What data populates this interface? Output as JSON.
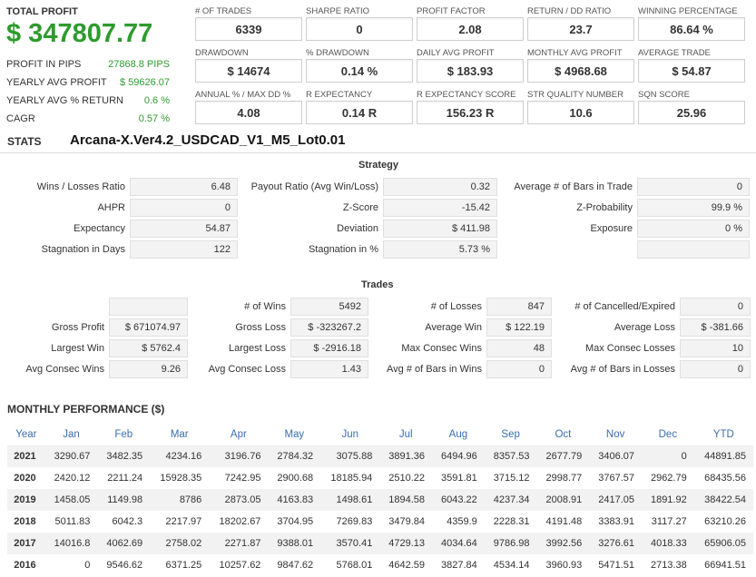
{
  "summary": {
    "total_profit_label": "TOTAL PROFIT",
    "total_profit_value": "$ 347807.77",
    "rows": [
      {
        "label": "PROFIT IN PIPS",
        "value": "27868.8 PIPS"
      },
      {
        "label": "YEARLY AVG PROFIT",
        "value": "$ 59626.07"
      },
      {
        "label": "YEARLY AVG % RETURN",
        "value": "0.6 %"
      },
      {
        "label": "CAGR",
        "value": "0.57 %"
      }
    ]
  },
  "metrics": [
    {
      "label": "# OF TRADES",
      "value": "6339"
    },
    {
      "label": "SHARPE RATIO",
      "value": "0"
    },
    {
      "label": "PROFIT FACTOR",
      "value": "2.08"
    },
    {
      "label": "RETURN / DD RATIO",
      "value": "23.7"
    },
    {
      "label": "WINNING PERCENTAGE",
      "value": "86.64 %"
    },
    {
      "label": "DRAWDOWN",
      "value": "$ 14674"
    },
    {
      "label": "% DRAWDOWN",
      "value": "0.14 %"
    },
    {
      "label": "DAILY AVG PROFIT",
      "value": "$ 183.93"
    },
    {
      "label": "MONTHLY AVG PROFIT",
      "value": "$ 4968.68"
    },
    {
      "label": "AVERAGE TRADE",
      "value": "$ 54.87"
    },
    {
      "label": "ANNUAL % / MAX DD %",
      "value": "4.08"
    },
    {
      "label": "R EXPECTANCY",
      "value": "0.14 R"
    },
    {
      "label": "R EXPECTANCY SCORE",
      "value": "156.23 R"
    },
    {
      "label": "STR QUALITY NUMBER",
      "value": "10.6"
    },
    {
      "label": "SQN SCORE",
      "value": "25.96"
    }
  ],
  "stats": {
    "label": "STATS",
    "strategy_name": "Arcana-X.Ver4.2_USDCAD_V1_M5_Lot0.01"
  },
  "strategy": {
    "title": "Strategy",
    "rows": [
      [
        {
          "label": "Wins / Losses Ratio",
          "value": "6.48"
        },
        {
          "label": "Payout Ratio (Avg Win/Loss)",
          "value": "0.32"
        },
        {
          "label": "Average # of Bars in Trade",
          "value": "0"
        }
      ],
      [
        {
          "label": "AHPR",
          "value": "0"
        },
        {
          "label": "Z-Score",
          "value": "-15.42"
        },
        {
          "label": "Z-Probability",
          "value": "99.9 %"
        }
      ],
      [
        {
          "label": "Expectancy",
          "value": "54.87"
        },
        {
          "label": "Deviation",
          "value": "$ 411.98"
        },
        {
          "label": "Exposure",
          "value": "0 %"
        }
      ],
      [
        {
          "label": "Stagnation in Days",
          "value": "122"
        },
        {
          "label": "Stagnation in %",
          "value": "5.73 %"
        },
        {
          "label": "",
          "value": ""
        }
      ]
    ]
  },
  "trades": {
    "title": "Trades",
    "rows": [
      [
        {
          "label": "",
          "value": ""
        },
        {
          "label": "# of Wins",
          "value": "5492"
        },
        {
          "label": "# of Losses",
          "value": "847"
        },
        {
          "label": "# of Cancelled/Expired",
          "value": "0"
        }
      ],
      [
        {
          "label": "Gross Profit",
          "value": "$ 671074.97"
        },
        {
          "label": "Gross Loss",
          "value": "$ -323267.2"
        },
        {
          "label": "Average Win",
          "value": "$ 122.19"
        },
        {
          "label": "Average Loss",
          "value": "$ -381.66"
        }
      ],
      [
        {
          "label": "Largest Win",
          "value": "$ 5762.4"
        },
        {
          "label": "Largest Loss",
          "value": "$ -2916.18"
        },
        {
          "label": "Max Consec Wins",
          "value": "48"
        },
        {
          "label": "Max Consec Losses",
          "value": "10"
        }
      ],
      [
        {
          "label": "Avg Consec Wins",
          "value": "9.26"
        },
        {
          "label": "Avg Consec Loss",
          "value": "1.43"
        },
        {
          "label": "Avg # of Bars in Wins",
          "value": "0"
        },
        {
          "label": "Avg # of Bars in Losses",
          "value": "0"
        }
      ]
    ]
  },
  "monthly": {
    "title": "MONTHLY PERFORMANCE ($)",
    "headers": [
      "Year",
      "Jan",
      "Feb",
      "Mar",
      "Apr",
      "May",
      "Jun",
      "Jul",
      "Aug",
      "Sep",
      "Oct",
      "Nov",
      "Dec",
      "YTD"
    ],
    "rows": [
      [
        "2021",
        "3290.67",
        "3482.35",
        "4234.16",
        "3196.76",
        "2784.32",
        "3075.88",
        "3891.36",
        "6494.96",
        "8357.53",
        "2677.79",
        "3406.07",
        "0",
        "44891.85"
      ],
      [
        "2020",
        "2420.12",
        "2211.24",
        "15928.35",
        "7242.95",
        "2900.68",
        "18185.94",
        "2510.22",
        "3591.81",
        "3715.12",
        "2998.77",
        "3767.57",
        "2962.79",
        "68435.56"
      ],
      [
        "2019",
        "1458.05",
        "1149.98",
        "8786",
        "2873.05",
        "4163.83",
        "1498.61",
        "1894.58",
        "6043.22",
        "4237.34",
        "2008.91",
        "2417.05",
        "1891.92",
        "38422.54"
      ],
      [
        "2018",
        "5011.83",
        "6042.3",
        "2217.97",
        "18202.67",
        "3704.95",
        "7269.83",
        "3479.84",
        "4359.9",
        "2228.31",
        "4191.48",
        "3383.91",
        "3117.27",
        "63210.26"
      ],
      [
        "2017",
        "14016.8",
        "4062.69",
        "2758.02",
        "2271.87",
        "9388.01",
        "3570.41",
        "4729.13",
        "4034.64",
        "9786.98",
        "3992.56",
        "3276.61",
        "4018.33",
        "65906.05"
      ],
      [
        "2016",
        "0",
        "9546.62",
        "6371.25",
        "10257.62",
        "9847.62",
        "5768.01",
        "4642.59",
        "3827.84",
        "4534.14",
        "3960.93",
        "5471.51",
        "2713.38",
        "66941.51"
      ]
    ]
  }
}
